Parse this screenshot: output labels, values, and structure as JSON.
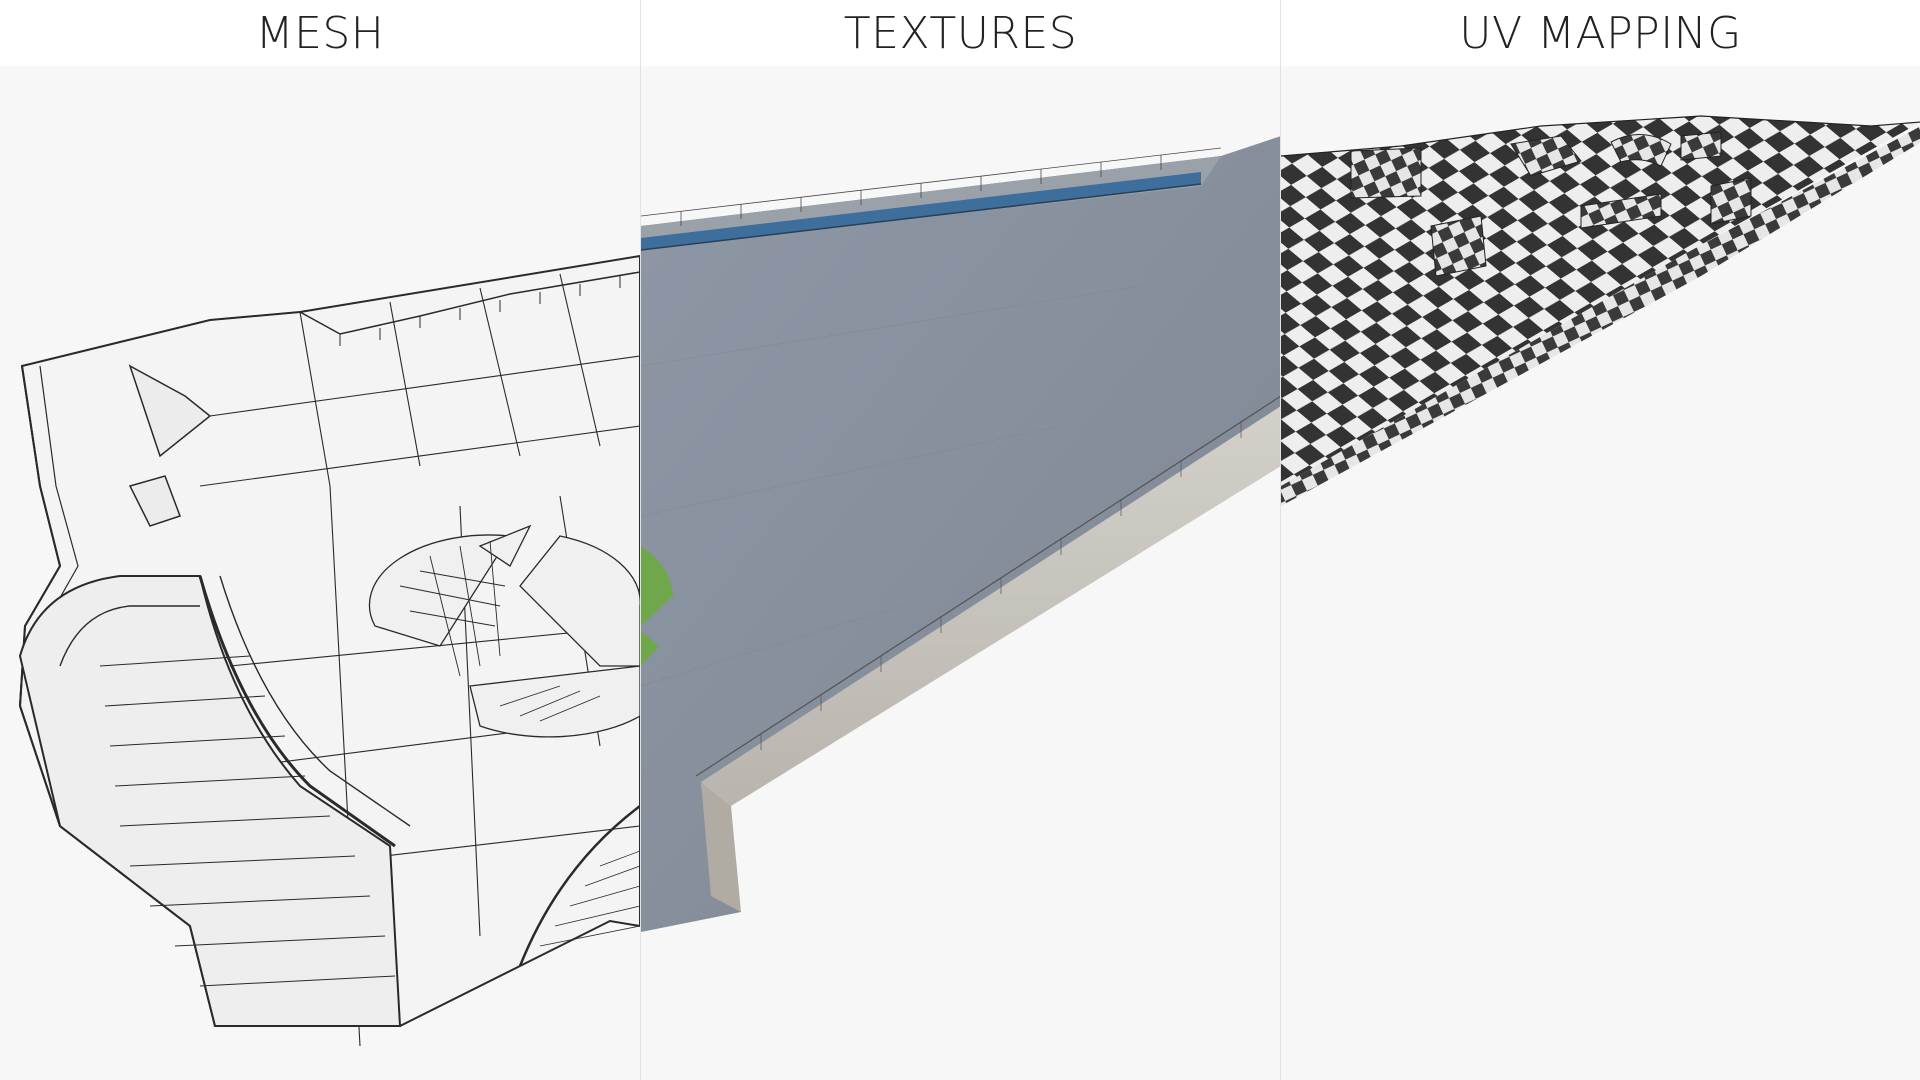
{
  "panels": [
    {
      "id": "mesh",
      "title": "MESH",
      "view": "wireframe render of terrace platform mesh"
    },
    {
      "id": "textures",
      "title": "TEXTURES",
      "view": "textured render of terrace platform"
    },
    {
      "id": "uv",
      "title": "UV MAPPING",
      "view": "checker UV test render of terrace platform"
    }
  ],
  "colors": {
    "background": "#f7f7f7",
    "header": "#ffffff",
    "mesh_fill": "#f4f4f4",
    "mesh_line": "#2a2a2a",
    "concrete": "#8a929f",
    "wall": "#c9c6c0",
    "water": "#3d6e9c",
    "grass": "#6ea84a",
    "checker_dark": "#333333",
    "checker_light": "#eeeeee"
  }
}
